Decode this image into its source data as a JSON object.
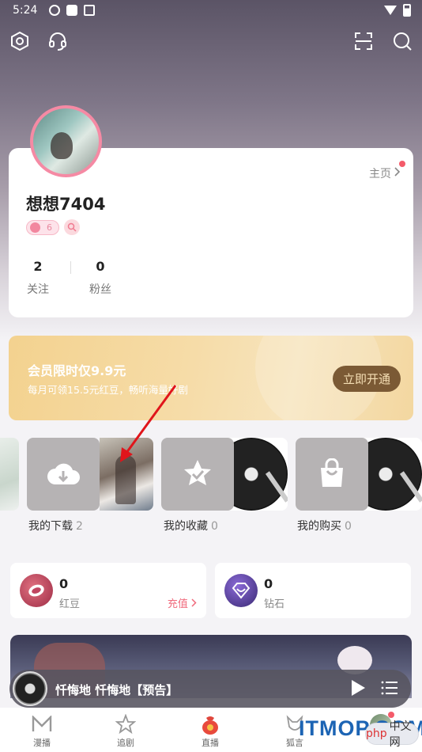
{
  "status_bar": {
    "time": "5:24"
  },
  "profile": {
    "home_label": "主页",
    "username": "想想7404",
    "level": "6",
    "following_count": "2",
    "following_label": "关注",
    "fans_count": "0",
    "fans_label": "粉丝"
  },
  "vip_banner": {
    "title": "会员限时仅9.9元",
    "subtitle": "每月可领15.5元红豆，畅听海量好剧",
    "button_label": "立即开通"
  },
  "tiles": [
    {
      "label": "我的下载",
      "count": "2"
    },
    {
      "label": "我的收藏",
      "count": "0"
    },
    {
      "label": "我的购买",
      "count": "0"
    }
  ],
  "wallet": {
    "red_bean": {
      "value": "0",
      "label": "红豆",
      "action": "充值"
    },
    "diamond": {
      "value": "0",
      "label": "钻石"
    }
  },
  "player": {
    "title": "忏悔地 忏悔地【预告】"
  },
  "bottom_nav": {
    "items": [
      {
        "label": "漫播"
      },
      {
        "label": "追剧"
      },
      {
        "label": "直播"
      },
      {
        "label": "狐言"
      }
    ]
  },
  "watermark": {
    "text": "ITMOP.COM",
    "badge_php": "php",
    "badge_cn": "中文网"
  },
  "colors": {
    "accent_pink": "#f58aa4",
    "vip_button": "#7b5a35",
    "recharge": "#f06a7c",
    "watermark_blue": "#1c64b4"
  }
}
